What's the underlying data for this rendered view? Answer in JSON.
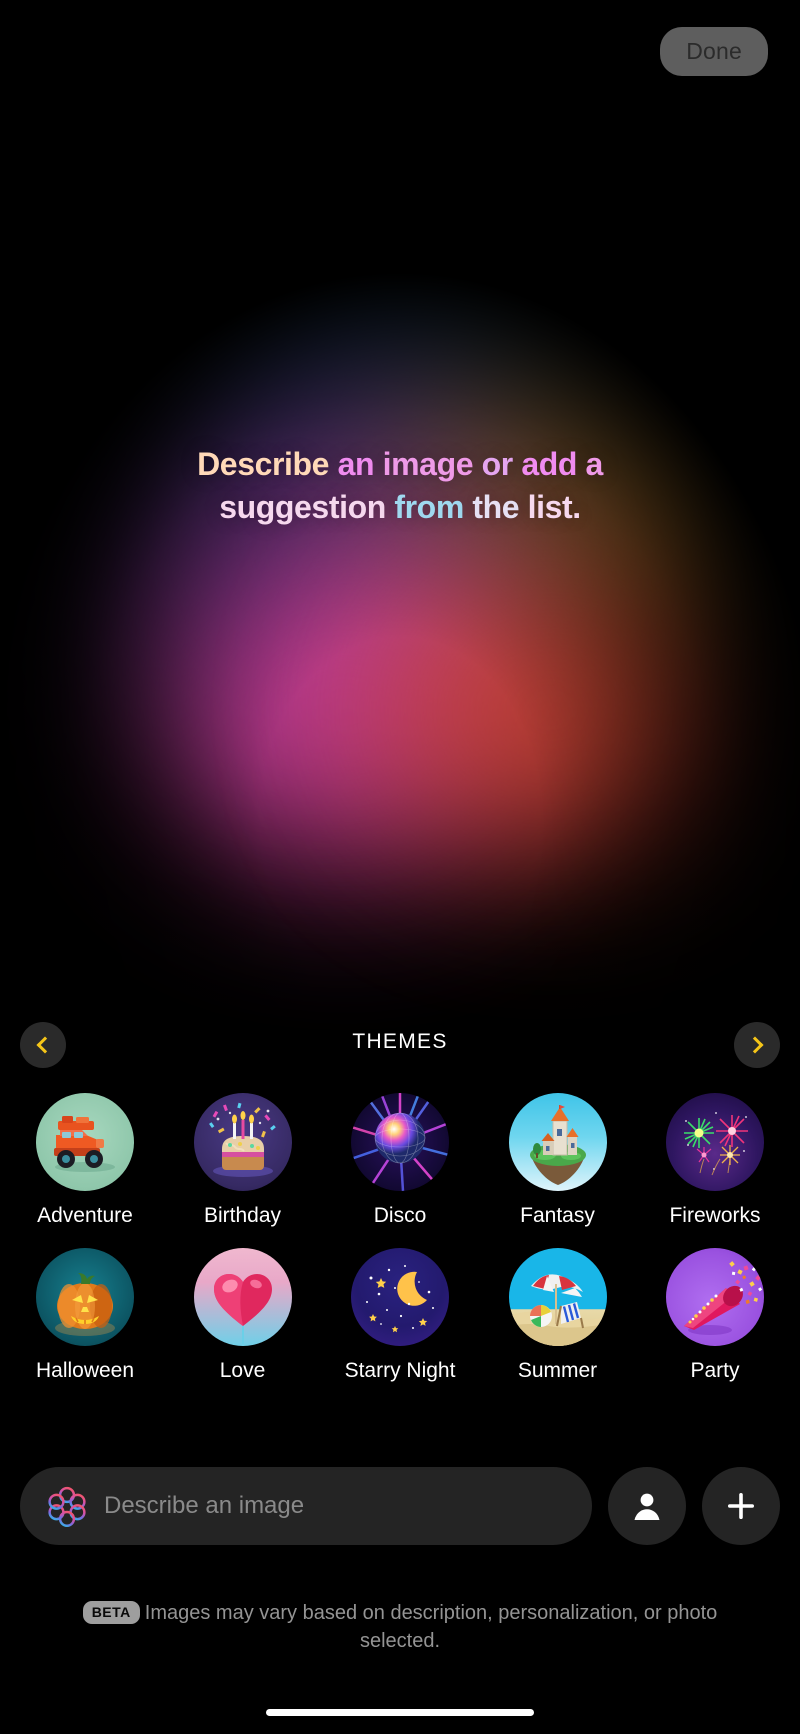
{
  "header": {
    "done_label": "Done"
  },
  "hero": {
    "line1": [
      {
        "text": "Describe ",
        "color": "peach"
      },
      {
        "text": "an ",
        "color": "magenta"
      },
      {
        "text": "image ",
        "color": "orchid"
      },
      {
        "text": "or ",
        "color": "violet"
      },
      {
        "text": "add ",
        "color": "magenta"
      },
      {
        "text": "a",
        "color": "orchid"
      }
    ],
    "line2": [
      {
        "text": "suggestion ",
        "color": "pinkw"
      },
      {
        "text": "from ",
        "color": "blue"
      },
      {
        "text": "the ",
        "color": "lav"
      },
      {
        "text": "list.",
        "color": "pinkw"
      }
    ],
    "plain": "Describe an image or add a suggestion from the list."
  },
  "themes": {
    "title": "THEMES",
    "prev_icon": "chevron-left-icon",
    "next_icon": "chevron-right-icon",
    "accent": "#f5c518",
    "rows": [
      [
        {
          "label": "Adventure",
          "art": "adventure"
        },
        {
          "label": "Birthday",
          "art": "birthday"
        },
        {
          "label": "Disco",
          "art": "disco"
        },
        {
          "label": "Fantasy",
          "art": "fantasy"
        },
        {
          "label": "Fireworks",
          "art": "fireworks"
        }
      ],
      [
        {
          "label": "Halloween",
          "art": "halloween"
        },
        {
          "label": "Love",
          "art": "love"
        },
        {
          "label": "Starry Night",
          "art": "starry"
        },
        {
          "label": "Summer",
          "art": "summer"
        },
        {
          "label": "Party",
          "art": "party"
        }
      ]
    ]
  },
  "composer": {
    "placeholder": "Describe an image",
    "value": "",
    "leading_icon": "image-playground-icon",
    "person_icon": "person-icon",
    "add_icon": "plus-icon"
  },
  "footer": {
    "badge": "BETA",
    "text": "Images may vary based on description, personalization, or photo selected."
  }
}
